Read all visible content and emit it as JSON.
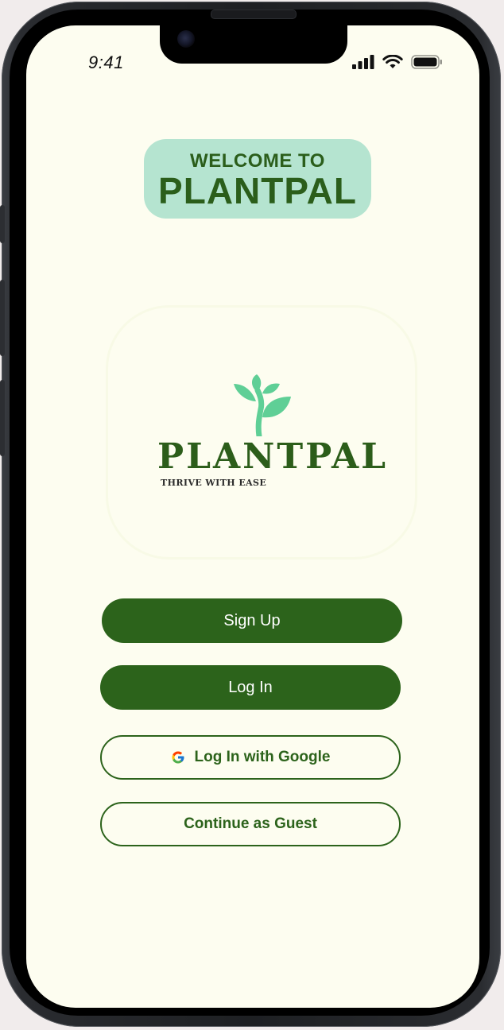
{
  "status_bar": {
    "time": "9:41"
  },
  "welcome": {
    "line1": "WELCOME TO",
    "line2": "PLANTPAL"
  },
  "logo": {
    "wordmark": "PLANTPAL",
    "tagline": "THRIVE WITH EASE",
    "icon": "sprout-icon"
  },
  "buttons": {
    "signup": "Sign Up",
    "login": "Log In",
    "google": "Log In with Google",
    "guest": "Continue as Guest"
  },
  "colors": {
    "primary": "#2c631b",
    "background": "#fdfdf0",
    "welcome_bg": "#b5e4d0",
    "leaf": "#5fcf96"
  }
}
